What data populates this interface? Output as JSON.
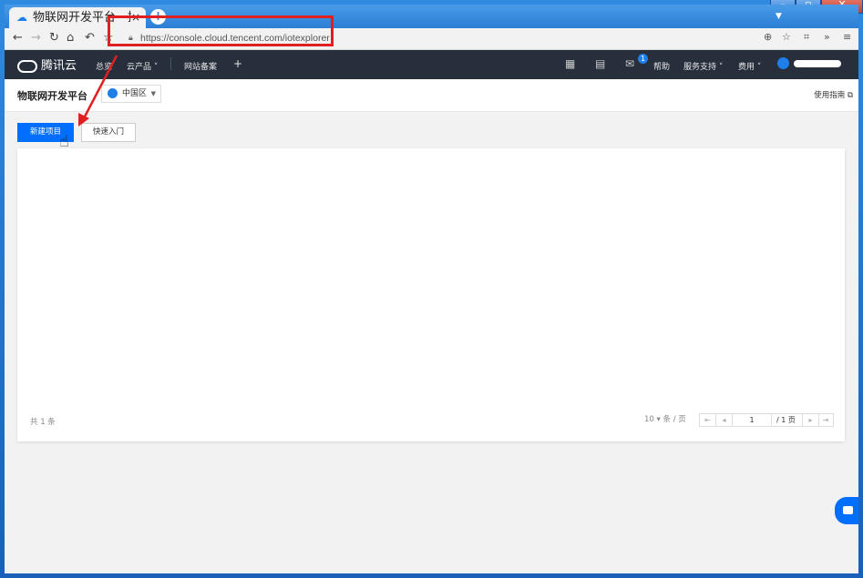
{
  "browser": {
    "tab_title": "物联网开发平台 - 控",
    "tab_close": "×",
    "new_tab": "+",
    "url": "https://console.cloud.tencent.com/iotexplorer"
  },
  "nav": {
    "logo_text": "腾讯云",
    "overview": "总览",
    "products": "云产品 ˅",
    "filing": "网站备案",
    "plus": "+",
    "help": "帮助",
    "support": "服务支持 ˅",
    "billing": "费用 ˅",
    "mail_badge": "1"
  },
  "header": {
    "title": "物联网开发平台",
    "region": "中国区",
    "guide": "使用指南 ⧉"
  },
  "actions": {
    "new_project": "新建项目",
    "quick_start": "快速入门"
  },
  "list": {
    "total": "共 1 条",
    "page_size": "10 ▾ 条 / 页",
    "page_input": "1",
    "page_of": "/ 1 页"
  },
  "colors": {
    "accent": "#006eff",
    "nav_bg": "#272f3c",
    "annotation": "#e02020"
  }
}
